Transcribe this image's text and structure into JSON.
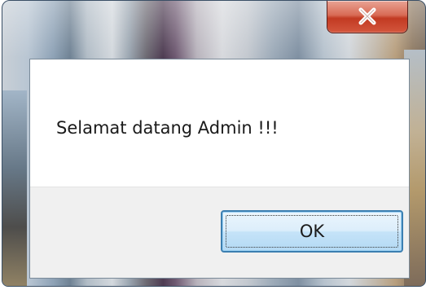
{
  "dialog": {
    "message": "Selamat datang Admin !!!",
    "ok_label": "OK",
    "close_glyph": "close-icon"
  },
  "colors": {
    "close_button": "#c23a22",
    "ok_border": "#3c7fb1",
    "ok_fill": "#dceefb",
    "client_bg": "#ffffff",
    "button_area_bg": "#f0f0f0"
  }
}
